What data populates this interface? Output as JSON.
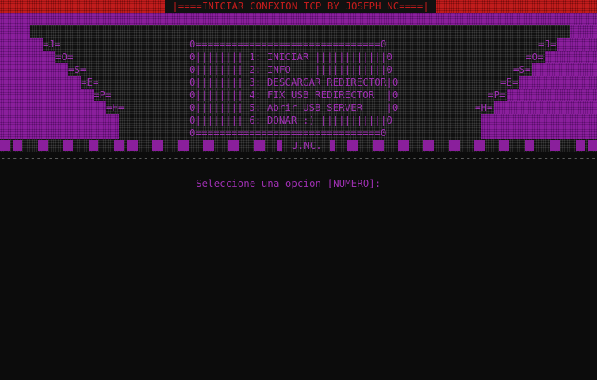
{
  "title": "|====INICIAR CONEXION TCP BY JOSEPH NC====|",
  "letters_left": [
    "=J=",
    "=O=",
    "=S=",
    "=E=",
    "=P=",
    "=H="
  ],
  "letters_right": [
    "=J=",
    "=O=",
    "=S=",
    "=E=",
    "=P=",
    "=H="
  ],
  "menu": {
    "border": "0===============================0",
    "items": [
      "0|||||||| 1: INICIAR ||||||||||||0",
      "0|||||||| 2: INFO    ||||||||||||0",
      "0|||||||| 3: DESCARGAR REDIRECTOR|0",
      "0|||||||| 4: FIX USB REDIRECTOR  |0",
      "0|||||||| 5: Abrir USB SERVER    |0",
      "0|||||||| 6: DONAR :) |||||||||||0"
    ]
  },
  "footer_text": "J.NC.",
  "separator": "-------------------------------------------------------------------------------------------------------------------------",
  "prompt": "Seleccione una opcion [NUMERO]:"
}
